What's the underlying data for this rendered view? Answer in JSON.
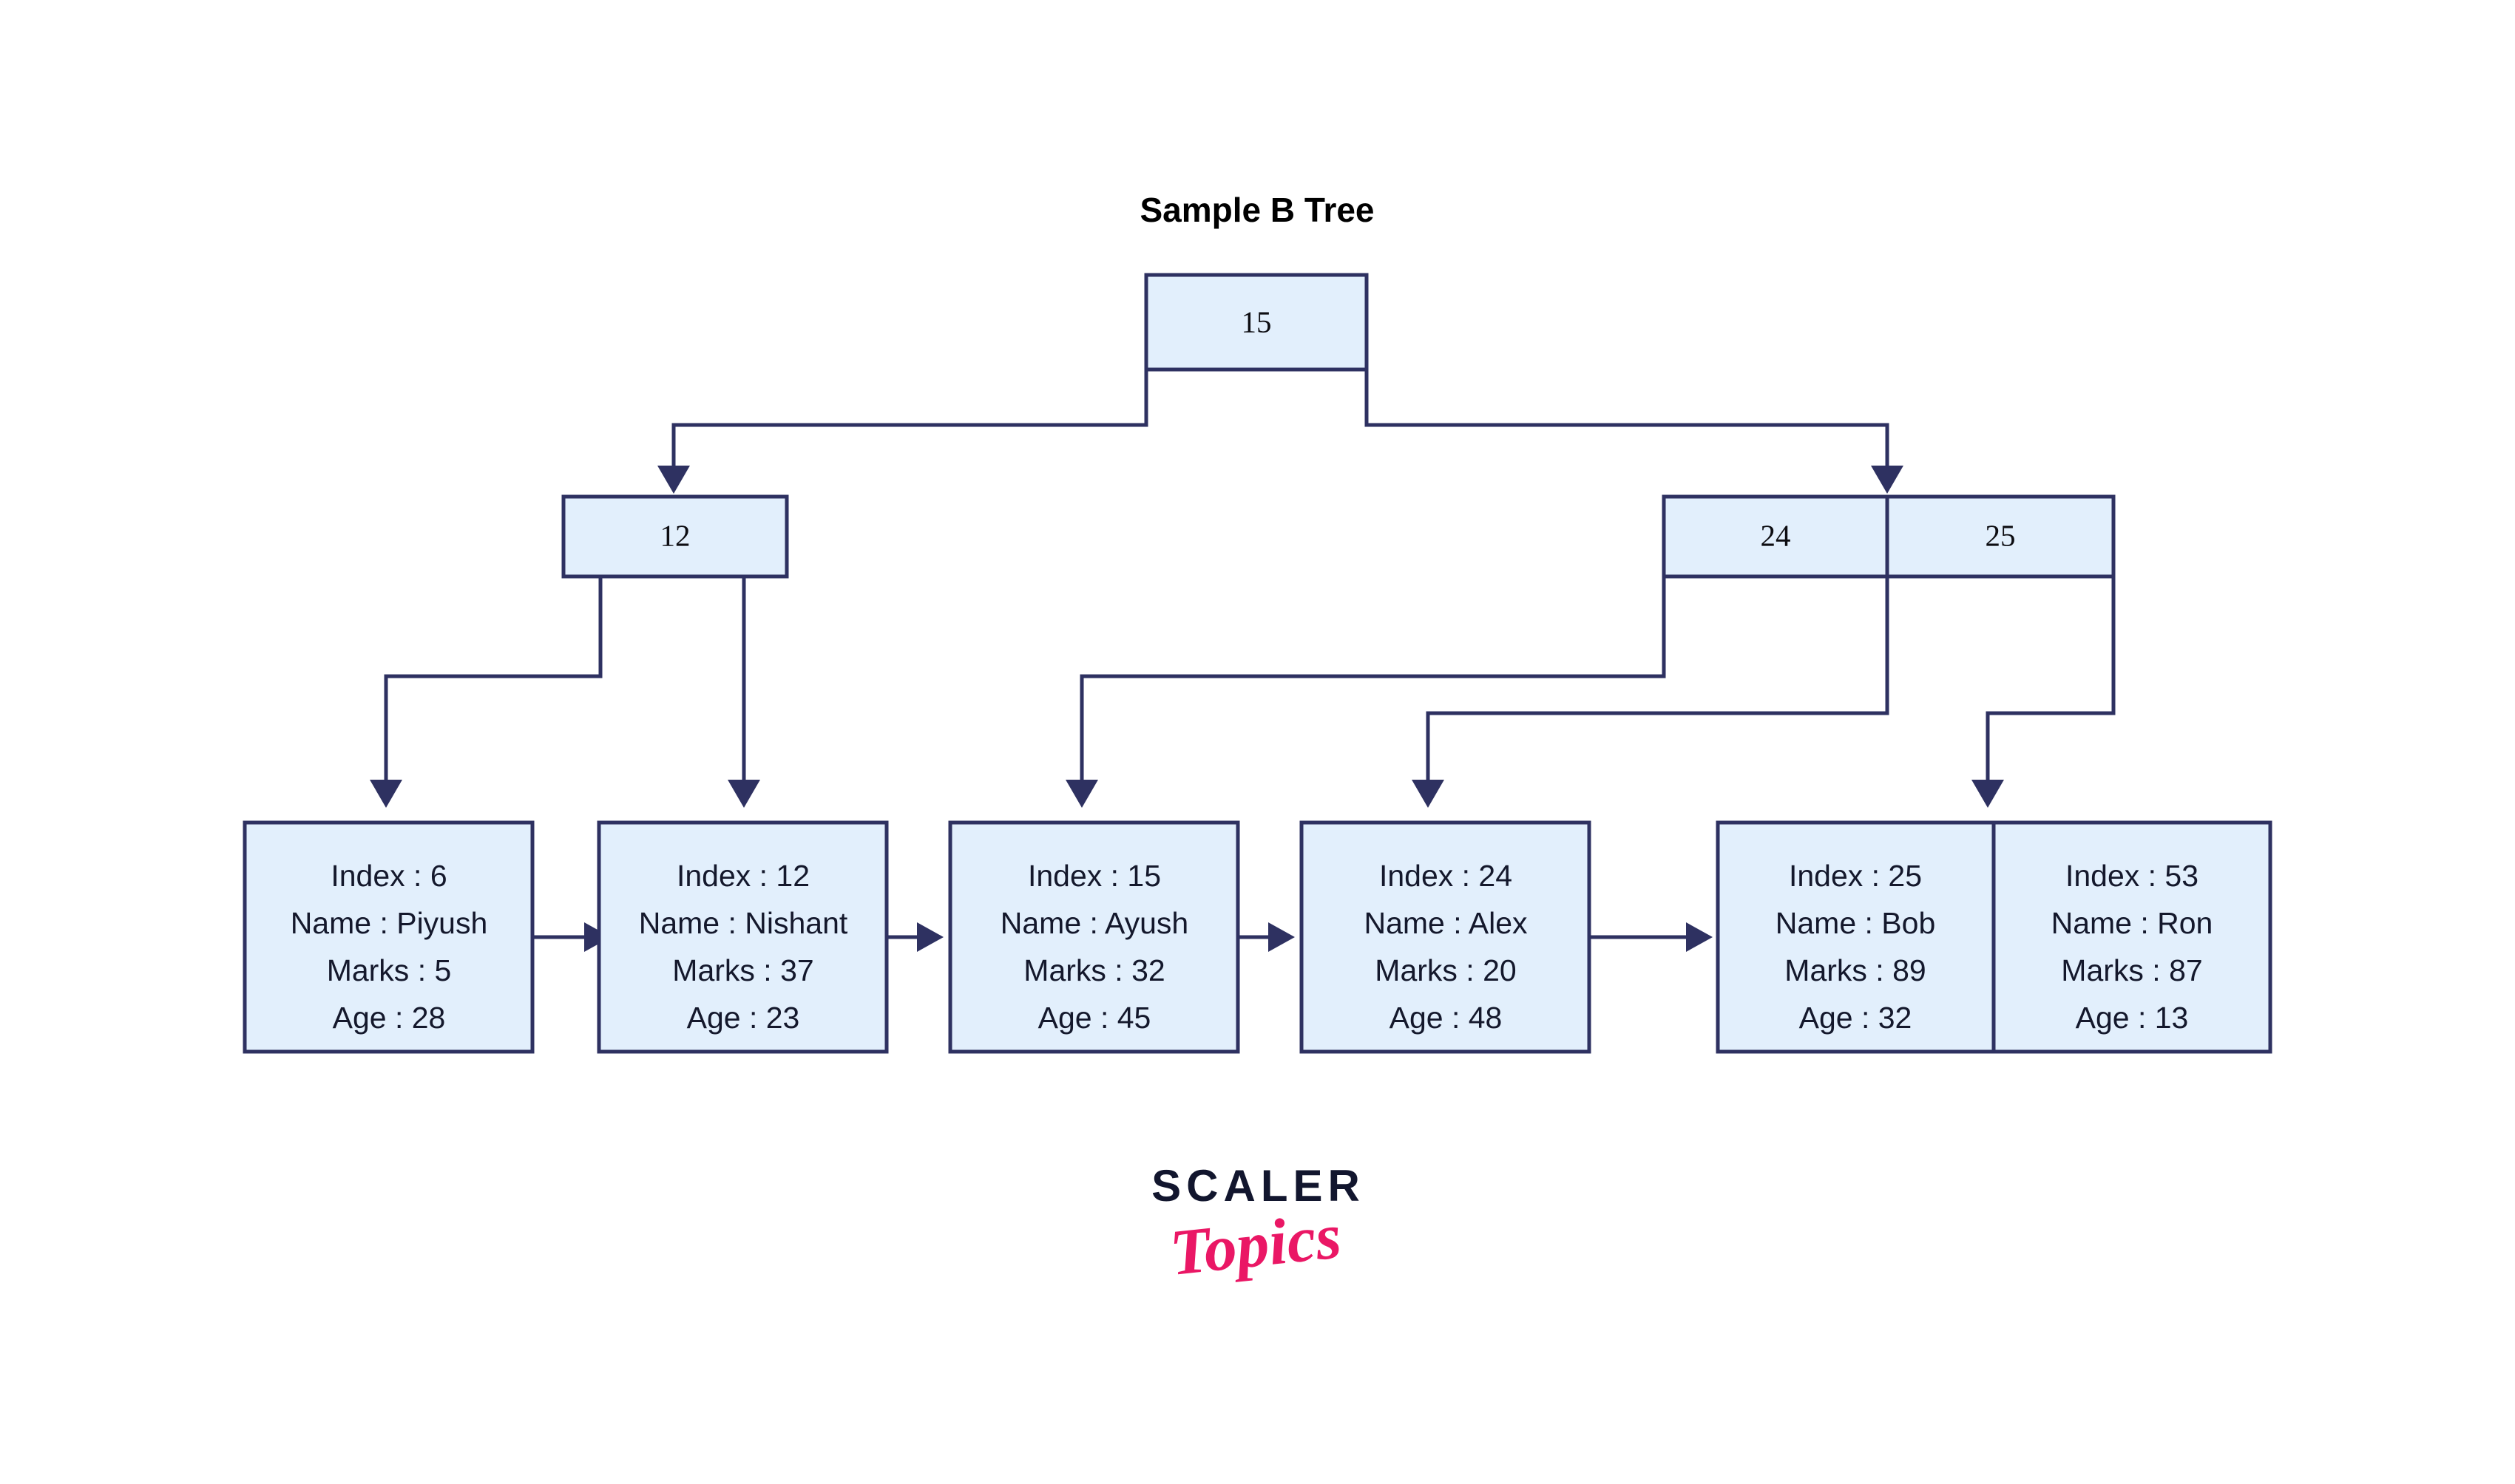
{
  "title": "Sample B Tree",
  "colors": {
    "node_fill": "#e2effc",
    "node_border": "#2e3161",
    "pointer_fill": "#ffffff",
    "text": "#14182c",
    "background": "#ffffff",
    "logo_dark": "#12162e",
    "logo_pink": "#ea1765"
  },
  "logo": {
    "line1": "SCALER",
    "line2": "Topics"
  },
  "tree": {
    "root": {
      "name": "root-node",
      "keys": [
        "15"
      ]
    },
    "internal": [
      {
        "name": "internal-node-left",
        "keys": [
          "12"
        ]
      },
      {
        "name": "internal-node-right",
        "keys": [
          "24",
          "25"
        ]
      }
    ],
    "leaves": [
      {
        "name": "leaf-node-1",
        "records": [
          {
            "index_label": "Index : 6",
            "name_label": "Name : Piyush",
            "marks_label": "Marks : 5",
            "age_label": "Age : 28"
          }
        ]
      },
      {
        "name": "leaf-node-2",
        "records": [
          {
            "index_label": "Index : 12",
            "name_label": "Name : Nishant",
            "marks_label": "Marks : 37",
            "age_label": "Age : 23"
          }
        ]
      },
      {
        "name": "leaf-node-3",
        "records": [
          {
            "index_label": "Index : 15",
            "name_label": "Name : Ayush",
            "marks_label": "Marks : 32",
            "age_label": "Age : 45"
          }
        ]
      },
      {
        "name": "leaf-node-4",
        "records": [
          {
            "index_label": "Index : 24",
            "name_label": "Name : Alex",
            "marks_label": "Marks : 20",
            "age_label": "Age : 48"
          }
        ]
      },
      {
        "name": "leaf-node-5",
        "records": [
          {
            "index_label": "Index : 25",
            "name_label": "Name : Bob",
            "marks_label": "Marks : 89",
            "age_label": "Age : 32"
          },
          {
            "index_label": "Index : 53",
            "name_label": "Name : Ron",
            "marks_label": "Marks : 87",
            "age_label": "Age : 13"
          }
        ]
      }
    ]
  },
  "chart_data": {
    "type": "diagram",
    "subtype": "b-tree",
    "title": "Sample B Tree",
    "levels": [
      {
        "level": 0,
        "nodes": [
          {
            "keys": [
              "15"
            ]
          }
        ]
      },
      {
        "level": 1,
        "nodes": [
          {
            "keys": [
              "12"
            ]
          },
          {
            "keys": [
              "24",
              "25"
            ]
          }
        ]
      },
      {
        "level": 2,
        "nodes": [
          {
            "records": [
              {
                "Index": 6,
                "Name": "Piyush",
                "Marks": 5,
                "Age": 28
              }
            ]
          },
          {
            "records": [
              {
                "Index": 12,
                "Name": "Nishant",
                "Marks": 37,
                "Age": 23
              }
            ]
          },
          {
            "records": [
              {
                "Index": 15,
                "Name": "Ayush",
                "Marks": 32,
                "Age": 45
              }
            ]
          },
          {
            "records": [
              {
                "Index": 24,
                "Name": "Alex",
                "Marks": 20,
                "Age": 48
              }
            ]
          },
          {
            "records": [
              {
                "Index": 25,
                "Name": "Bob",
                "Marks": 89,
                "Age": 32
              },
              {
                "Index": 53,
                "Name": "Ron",
                "Marks": 87,
                "Age": 13
              }
            ]
          }
        ]
      }
    ],
    "edges": [
      {
        "from": "15",
        "to": "12"
      },
      {
        "from": "15",
        "to": "24,25"
      },
      {
        "from": "12",
        "to": "Index : 6"
      },
      {
        "from": "12",
        "to": "Index : 12"
      },
      {
        "from": "24,25",
        "to": "Index : 15"
      },
      {
        "from": "24,25",
        "to": "Index : 24"
      },
      {
        "from": "24,25",
        "to": "Index : 25"
      }
    ],
    "leaf_chain": [
      "Index : 6",
      "Index : 12",
      "Index : 15",
      "Index : 24",
      "Index : 25"
    ]
  }
}
